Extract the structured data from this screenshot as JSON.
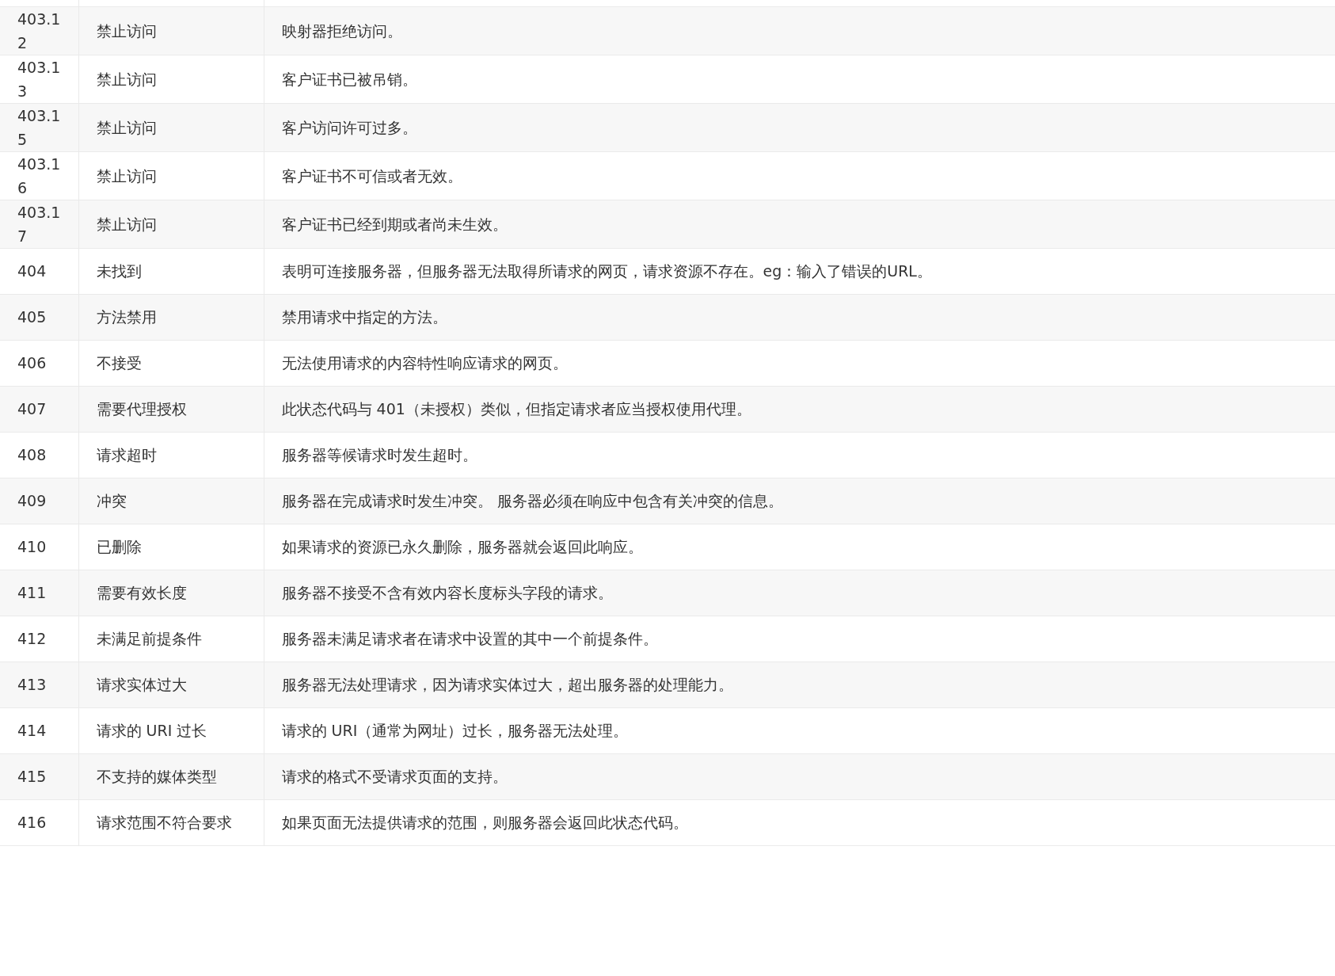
{
  "table": {
    "rows": [
      {
        "code": "403.12",
        "name": "禁止访问",
        "description": "映射器拒绝访问。"
      },
      {
        "code": "403.13",
        "name": "禁止访问",
        "description": "客户证书已被吊销。"
      },
      {
        "code": "403.15",
        "name": "禁止访问",
        "description": "客户访问许可过多。"
      },
      {
        "code": "403.16",
        "name": "禁止访问",
        "description": "客户证书不可信或者无效。"
      },
      {
        "code": "403.17",
        "name": "禁止访问",
        "description": "客户证书已经到期或者尚未生效。"
      },
      {
        "code": "404",
        "name": "未找到",
        "description": "表明可连接服务器，但服务器无法取得所请求的网页，请求资源不存在。eg：输入了错误的URL。"
      },
      {
        "code": "405",
        "name": "方法禁用",
        "description": "禁用请求中指定的方法。"
      },
      {
        "code": "406",
        "name": "不接受",
        "description": "无法使用请求的内容特性响应请求的网页。"
      },
      {
        "code": "407",
        "name": "需要代理授权",
        "description": "此状态代码与 401（未授权）类似，但指定请求者应当授权使用代理。"
      },
      {
        "code": "408",
        "name": "请求超时",
        "description": "服务器等候请求时发生超时。"
      },
      {
        "code": "409",
        "name": "冲突",
        "description": "服务器在完成请求时发生冲突。 服务器必须在响应中包含有关冲突的信息。"
      },
      {
        "code": "410",
        "name": "已删除",
        "description": "如果请求的资源已永久删除，服务器就会返回此响应。"
      },
      {
        "code": "411",
        "name": "需要有效长度",
        "description": "服务器不接受不含有效内容长度标头字段的请求。"
      },
      {
        "code": "412",
        "name": "未满足前提条件",
        "description": "服务器未满足请求者在请求中设置的其中一个前提条件。"
      },
      {
        "code": "413",
        "name": "请求实体过大",
        "description": "服务器无法处理请求，因为请求实体过大，超出服务器的处理能力。"
      },
      {
        "code": "414",
        "name": "请求的 URI 过长",
        "description": "请求的 URI（通常为网址）过长，服务器无法处理。"
      },
      {
        "code": "415",
        "name": "不支持的媒体类型",
        "description": "请求的格式不受请求页面的支持。"
      },
      {
        "code": "416",
        "name": "请求范围不符合要求",
        "description": "如果页面无法提供请求的范围，则服务器会返回此状态代码。"
      }
    ]
  }
}
